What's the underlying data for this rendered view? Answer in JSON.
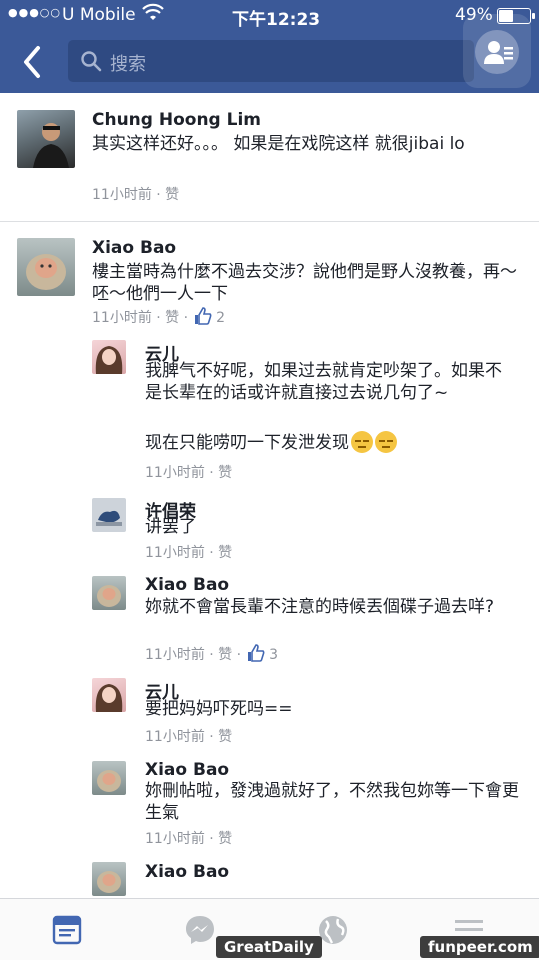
{
  "status_bar": {
    "signal": "●●●○○",
    "carrier": "U Mobile",
    "time": "下午12:23",
    "battery": "49%",
    "battery_level": 0.49
  },
  "nav": {
    "search_placeholder": "搜索",
    "brand_color": "#3b5998"
  },
  "comments": [
    {
      "name": "Chung Hoong Lim",
      "text": "其实这样还好。。。 如果是在戏院这样 就很jibai lo",
      "meta": "11小时前 · 赞",
      "likes": ""
    },
    {
      "name": "Xiao Bao",
      "text": "樓主當時為什麼不過去交涉？說他們是野人沒教養，再～呸～他們一人一下",
      "meta": "11小时前 · 赞 ·",
      "likes": "2"
    }
  ],
  "replies": [
    {
      "name": "云儿",
      "text": "我脾气不好呢，如果过去就肯定吵架了。如果不是长辈在的话或许就直接过去说几句了~",
      "text2": "现在只能唠叨一下发泄发现",
      "meta": "11小时前 · 赞",
      "likes": ""
    },
    {
      "name": "许倡荣",
      "text": "讲罢了",
      "meta": "11小时前 · 赞",
      "likes": ""
    },
    {
      "name": "Xiao Bao",
      "text": "妳就不會當長輩不注意的時候丟個碟子過去咩?",
      "meta": "11小时前 · 赞 ·",
      "likes": "3"
    },
    {
      "name": "云儿",
      "text": "要把妈妈吓死吗==",
      "meta": "11小时前 · 赞",
      "likes": ""
    },
    {
      "name": "Xiao Bao",
      "text": "妳刪帖啦，發洩過就好了，不然我包妳等一下會更生氣",
      "meta": "11小时前 · 赞",
      "likes": ""
    },
    {
      "name": "Xiao Bao",
      "text": "",
      "meta": "",
      "likes": ""
    }
  ],
  "tabbar": {
    "tabs": [
      "feed-icon",
      "messenger-icon",
      "globe-icon",
      "menu-icon"
    ],
    "active_color": "#4267b2"
  },
  "watermarks": {
    "left": "GreatDaily",
    "right": "funpeer.com"
  }
}
